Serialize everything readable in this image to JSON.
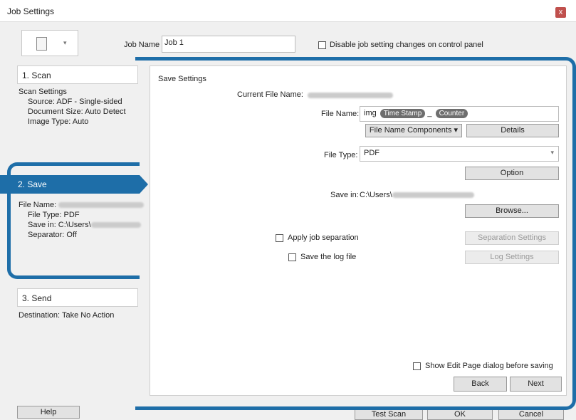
{
  "window": {
    "title": "Job Settings",
    "close_glyph": "x"
  },
  "header": {
    "job_name_label": "Job Name",
    "job_name_value": "Job 1",
    "disable_changes_label": "Disable job setting changes on control panel",
    "disable_changes_checked": false
  },
  "steps": {
    "scan": {
      "label": "1. Scan",
      "heading": "Scan Settings",
      "source": "Source: ADF - Single-sided",
      "document_size": "Document Size: Auto Detect",
      "image_type": "Image Type: Auto"
    },
    "save": {
      "label": "2. Save",
      "file_name": "File Name:",
      "file_type": "File Type: PDF",
      "save_in": "Save in: C:\\Users\\",
      "separator": "Separator: Off"
    },
    "send": {
      "label": "3. Send",
      "destination": "Destination: Take No Action"
    }
  },
  "save_settings": {
    "heading": "Save Settings",
    "current_file_name_label": "Current File Name:",
    "file_name_label": "File Name:",
    "file_name_prefix": "img",
    "file_name_tokens": [
      "Time Stamp",
      "Counter"
    ],
    "file_name_separator": "_",
    "file_name_components_label": "File Name Components",
    "details_label": "Details",
    "file_type_label": "File Type:",
    "file_type_value": "PDF",
    "option_label": "Option",
    "save_in_label": "Save in:",
    "save_in_value": "C:\\Users\\",
    "browse_label": "Browse...",
    "apply_job_separation_label": "Apply job separation",
    "separation_settings_label": "Separation Settings",
    "save_log_label": "Save the log file",
    "log_settings_label": "Log Settings",
    "show_edit_page_label": "Show Edit Page dialog before saving",
    "back_label": "Back",
    "next_label": "Next"
  },
  "footer": {
    "help_label": "Help",
    "test_scan_label": "Test Scan",
    "ok_label": "OK",
    "cancel_label": "Cancel"
  },
  "colors": {
    "accent": "#1e6ea8",
    "close": "#c0504d"
  }
}
